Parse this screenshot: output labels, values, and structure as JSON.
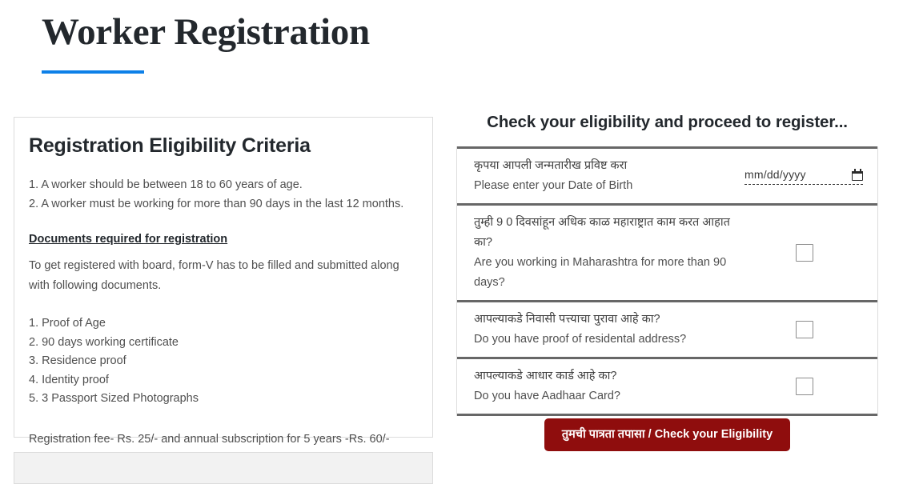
{
  "page": {
    "title": "Worker Registration"
  },
  "left_card": {
    "heading": "Registration Eligibility Criteria",
    "criteria": [
      "1. A worker should be between 18 to 60 years of age.",
      "2. A worker must be working for more than 90 days in the last 12 months."
    ],
    "documents_heading": "Documents required for registration",
    "documents_intro": "To get registered with board, form-V has to be filled and submitted along with following documents.",
    "documents": [
      "1. Proof of Age",
      "2. 90 days working certificate",
      "3. Residence proof",
      "4. Identity proof",
      "5. 3 Passport Sized Photographs"
    ],
    "fee_note": "Registration fee- Rs. 25/- and annual subscription for 5 years -Rs. 60/-"
  },
  "right_panel": {
    "heading": "Check your eligibility and proceed to register...",
    "rows": [
      {
        "question_mr": "कृपया आपली जन्मतारीख प्रविष्ट करा",
        "question_en": "Please enter your Date of Birth",
        "control": "date",
        "date_placeholder": "mm/dd/yyyy",
        "date_value": "",
        "icon": "calendar-icon"
      },
      {
        "question_mr": "तुम्ही 9 0 दिवसांहून अधिक काळ महाराष्ट्रात काम करत आहात का?",
        "question_en": "Are you working in Maharashtra for more than 90 days?",
        "control": "checkbox",
        "checked": false
      },
      {
        "question_mr": "आपल्याकडे निवासी पत्त्याचा पुरावा आहे का?",
        "question_en": "Do you have proof of residental address?",
        "control": "checkbox",
        "checked": false
      },
      {
        "question_mr": "आपल्याकडे आधार कार्ड आहे का?",
        "question_en": "Do you have Aadhaar Card?",
        "control": "checkbox",
        "checked": false
      }
    ],
    "submit_label": "तुमची पात्रता तपासा / Check your Eligibility"
  },
  "colors": {
    "accent_blue": "#0d80e8",
    "button_red": "#8f0d0d",
    "heading_dark": "#23282d",
    "body_gray": "#4f4f4f",
    "rule_gray": "#676767",
    "panel_gray": "#f2f2f2"
  }
}
